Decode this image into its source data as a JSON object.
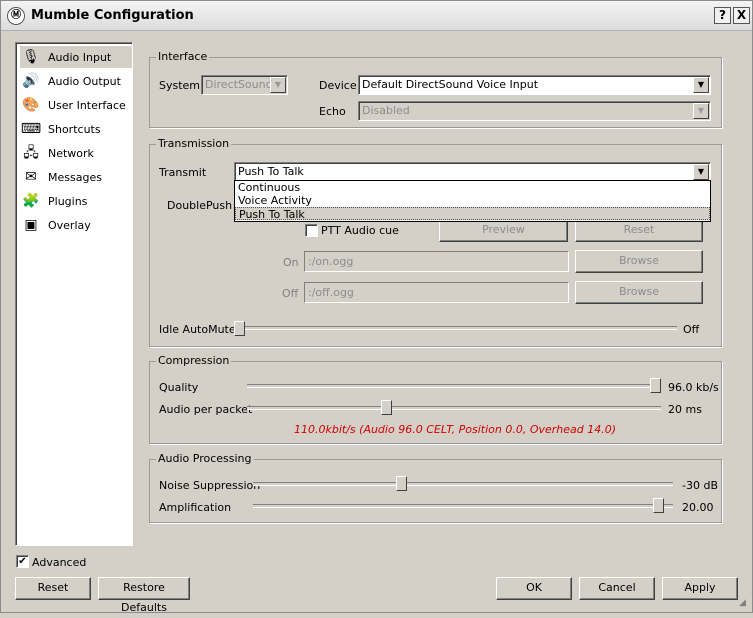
{
  "window": {
    "title": "Mumble Configuration",
    "help_button": "?",
    "close_button": "X"
  },
  "sidebar": {
    "items": [
      {
        "label": "Audio Input",
        "icon": "microphone-icon",
        "selected": true
      },
      {
        "label": "Audio Output",
        "icon": "speaker-icon"
      },
      {
        "label": "User Interface",
        "icon": "palette-icon"
      },
      {
        "label": "Shortcuts",
        "icon": "shortcuts-icon"
      },
      {
        "label": "Network",
        "icon": "network-icon"
      },
      {
        "label": "Messages",
        "icon": "messages-icon"
      },
      {
        "label": "Plugins",
        "icon": "plugins-icon"
      },
      {
        "label": "Overlay",
        "icon": "overlay-icon"
      }
    ]
  },
  "interface": {
    "title": "Interface",
    "system_label": "System",
    "system_value": "DirectSound",
    "device_label": "Device",
    "device_value": "Default DirectSound Voice Input",
    "echo_label": "Echo",
    "echo_value": "Disabled"
  },
  "transmission": {
    "title": "Transmission",
    "transmit_label": "Transmit",
    "transmit_value": "Push To Talk",
    "transmit_options": [
      "Continuous",
      "Voice Activity",
      "Push To Talk"
    ],
    "doublepush_label": "DoublePush T",
    "ptt_audio_cue_label": "PTT Audio cue",
    "preview_button": "Preview",
    "reset_button": "Reset",
    "on_label": "On",
    "on_value": ":/on.ogg",
    "off_label": "Off",
    "off_value": ":/off.ogg",
    "browse_button": "Browse",
    "idle_automute_label": "Idle AutoMute",
    "idle_automute_value": "Off"
  },
  "compression": {
    "title": "Compression",
    "quality_label": "Quality",
    "quality_value": "96.0 kb/s",
    "audio_per_packet_label": "Audio per packet",
    "audio_per_packet_value": "20 ms",
    "bitrate_info": "110.0kbit/s (Audio 96.0 CELT, Position 0.0, Overhead 14.0)"
  },
  "audio_processing": {
    "title": "Audio Processing",
    "noise_suppression_label": "Noise Suppression",
    "noise_suppression_value": "-30 dB",
    "amplification_label": "Amplification",
    "amplification_value": "20.00"
  },
  "footer": {
    "advanced_label": "Advanced",
    "reset_button": "Reset",
    "restore_defaults_button": "Restore Defaults",
    "ok_button": "OK",
    "cancel_button": "Cancel",
    "apply_button": "Apply"
  }
}
